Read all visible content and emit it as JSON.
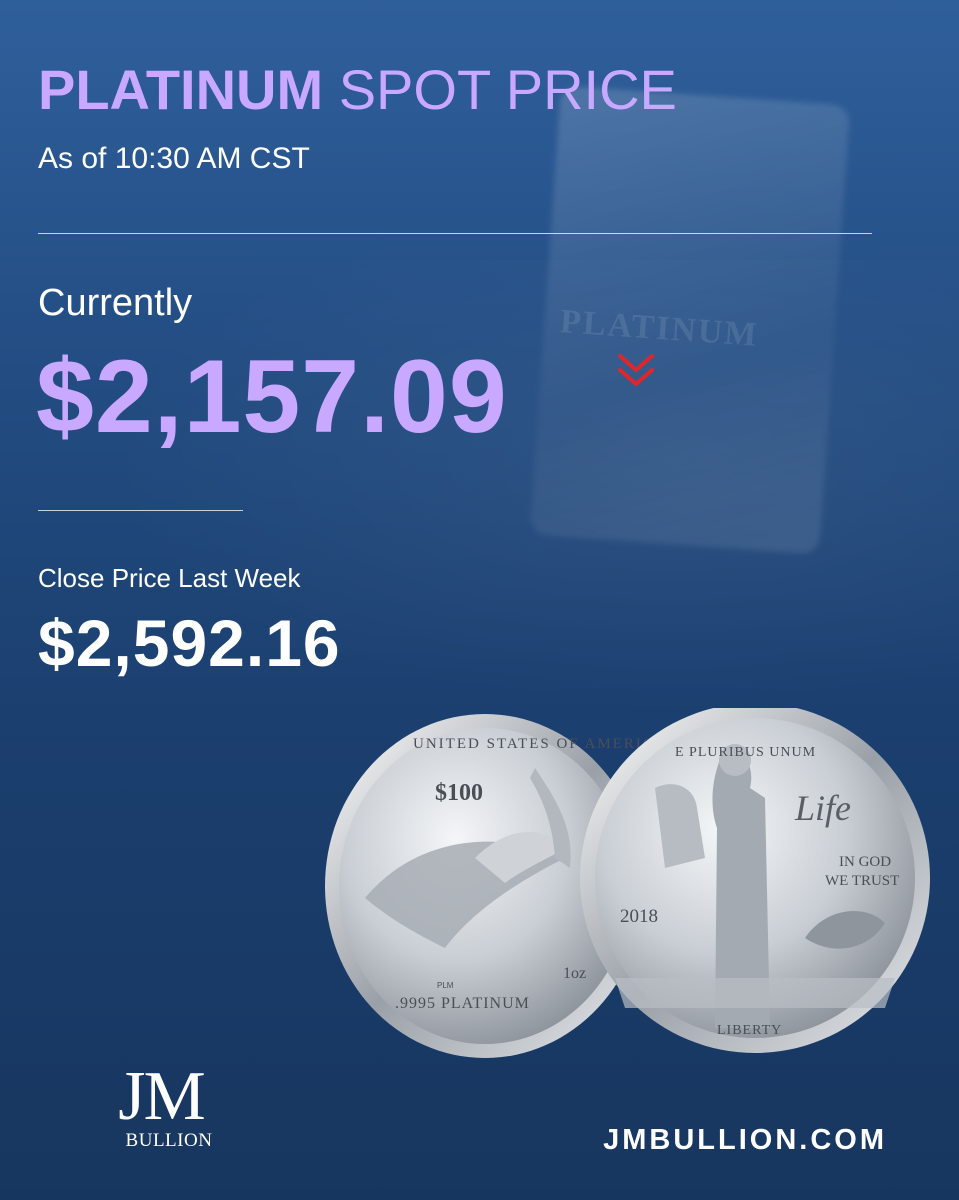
{
  "header": {
    "title_bold": "PLATINUM",
    "title_light": "SPOT PRICE",
    "timestamp": "As of 10:30 AM CST"
  },
  "current": {
    "label": "Currently",
    "price": "$2,157.09",
    "trend_icon": "double-chevron-down-icon",
    "trend_color": "#e0262a"
  },
  "last_week": {
    "label": "Close Price Last Week",
    "price": "$2,592.16"
  },
  "coin_front": {
    "legend": "UNITED STATES OF AMERICA",
    "denomination": "$100",
    "purity": ".9995 PLATINUM",
    "weight": "1oz",
    "initials": "PLM"
  },
  "coin_back": {
    "motto": "E PLURIBUS UNUM",
    "script": "Life",
    "trust_line1": "IN GOD",
    "trust_line2": "WE TRUST",
    "year": "2018",
    "liberty": "LIBERTY"
  },
  "background_bar": {
    "text": "PLATINUM"
  },
  "brand": {
    "logo_main": "JM",
    "logo_sub": "BULLION",
    "url": "JMBULLION.COM"
  },
  "colors": {
    "accent": "#c9a8ff",
    "background_top": "#2f5f9b",
    "background_bottom": "#17365f",
    "text": "#ffffff"
  }
}
